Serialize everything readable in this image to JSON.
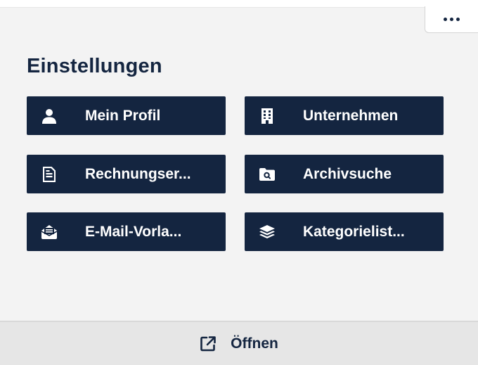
{
  "header": {
    "more_icon": "more-horizontal-icon"
  },
  "settings": {
    "title": "Einstellungen",
    "tiles": [
      {
        "label": "Mein Profil",
        "icon": "user-icon"
      },
      {
        "label": "Unternehmen",
        "icon": "building-icon"
      },
      {
        "label": "Rechnungser...",
        "icon": "document-icon"
      },
      {
        "label": "Archivsuche",
        "icon": "folder-search-icon"
      },
      {
        "label": "E-Mail-Vorla...",
        "icon": "envelope-open-icon"
      },
      {
        "label": "Kategorielist...",
        "icon": "layers-icon"
      }
    ]
  },
  "footer": {
    "open_label": "Öffnen",
    "open_icon": "external-link-icon"
  },
  "colors": {
    "primary": "#142540",
    "panel_bg": "#f3f3f3",
    "footer_bg": "#e6e6e6",
    "text_on_primary": "#ffffff"
  }
}
